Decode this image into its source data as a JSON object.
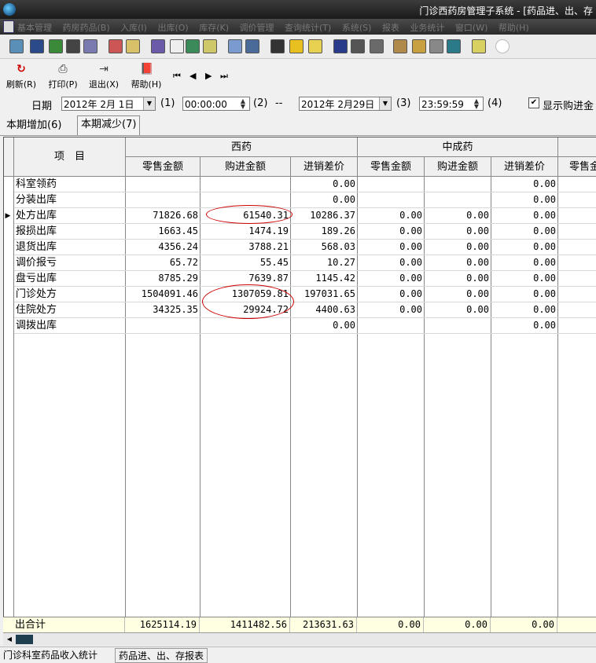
{
  "window": {
    "title": "门诊西药房管理子系统 - [药品进、出、存"
  },
  "menu": {
    "items": [
      "基本管理",
      "药房药品(B)",
      "入库(I)",
      "出库(O)",
      "库存(K)",
      "调价管理",
      "查询统计(T)",
      "系统(S)",
      "报表",
      "业务统计",
      "窗口(W)",
      "帮助(H)"
    ]
  },
  "toolbar": {
    "refresh": "刷新(R)",
    "print": "打印(P)",
    "exit": "退出(X)",
    "help": "帮助(H)",
    "nav": {
      "first": "⏮",
      "prev": "◀",
      "next": "▶",
      "last": "⏭"
    }
  },
  "filter": {
    "date_label": "日期",
    "start_date": "2012年 2月 1日",
    "start_time": "00:00:00",
    "start_date_key": "(1)",
    "start_time_key": "(2)",
    "separator": "--",
    "end_date": "2012年 2月29日",
    "end_time": "23:59:59",
    "end_date_key": "(3)",
    "end_time_key": "(4)",
    "show_purchase_label": "显示购进金",
    "show_purchase_checked": "✔"
  },
  "tabs": [
    {
      "label": "本期增加(6)"
    },
    {
      "label": "本期减少(7)"
    }
  ],
  "grid": {
    "col_item": "项　目",
    "groups": [
      "西药",
      "中成药"
    ],
    "subheaders": [
      "零售金额",
      "购进金额",
      "进销差价",
      "零售金额",
      "购进金额",
      "进销差价",
      "零售金"
    ],
    "rows": [
      {
        "name": "科室领药",
        "v": [
          "",
          "",
          "0.00",
          "",
          "",
          "0.00"
        ]
      },
      {
        "name": "分装出库",
        "v": [
          "",
          "",
          "0.00",
          "",
          "",
          "0.00"
        ]
      },
      {
        "name": "处方出库",
        "v": [
          "71826.68",
          "61540.31",
          "10286.37",
          "0.00",
          "0.00",
          "0.00"
        ]
      },
      {
        "name": "报损出库",
        "v": [
          "1663.45",
          "1474.19",
          "189.26",
          "0.00",
          "0.00",
          "0.00"
        ]
      },
      {
        "name": "退货出库",
        "v": [
          "4356.24",
          "3788.21",
          "568.03",
          "0.00",
          "0.00",
          "0.00"
        ]
      },
      {
        "name": "调价报亏",
        "v": [
          "65.72",
          "55.45",
          "10.27",
          "0.00",
          "0.00",
          "0.00"
        ]
      },
      {
        "name": "盘亏出库",
        "v": [
          "8785.29",
          "7639.87",
          "1145.42",
          "0.00",
          "0.00",
          "0.00"
        ]
      },
      {
        "name": "门诊处方",
        "v": [
          "1504091.46",
          "1307059.81",
          "197031.65",
          "0.00",
          "0.00",
          "0.00"
        ]
      },
      {
        "name": "住院处方",
        "v": [
          "34325.35",
          "29924.72",
          "4400.63",
          "0.00",
          "0.00",
          "0.00"
        ]
      },
      {
        "name": "调拨出库",
        "v": [
          "",
          "",
          "0.00",
          "",
          "",
          "0.00"
        ]
      }
    ],
    "current_row_marker": "▶",
    "total": {
      "name": "出合计",
      "v": [
        "1625114.19",
        "1411482.56",
        "213631.63",
        "0.00",
        "0.00",
        "0.00"
      ]
    }
  },
  "scroll": {
    "left_arrow": "◀"
  },
  "statusbar": {
    "left": "门诊科室药品收入统计",
    "right": "药品进、出、存报表"
  }
}
